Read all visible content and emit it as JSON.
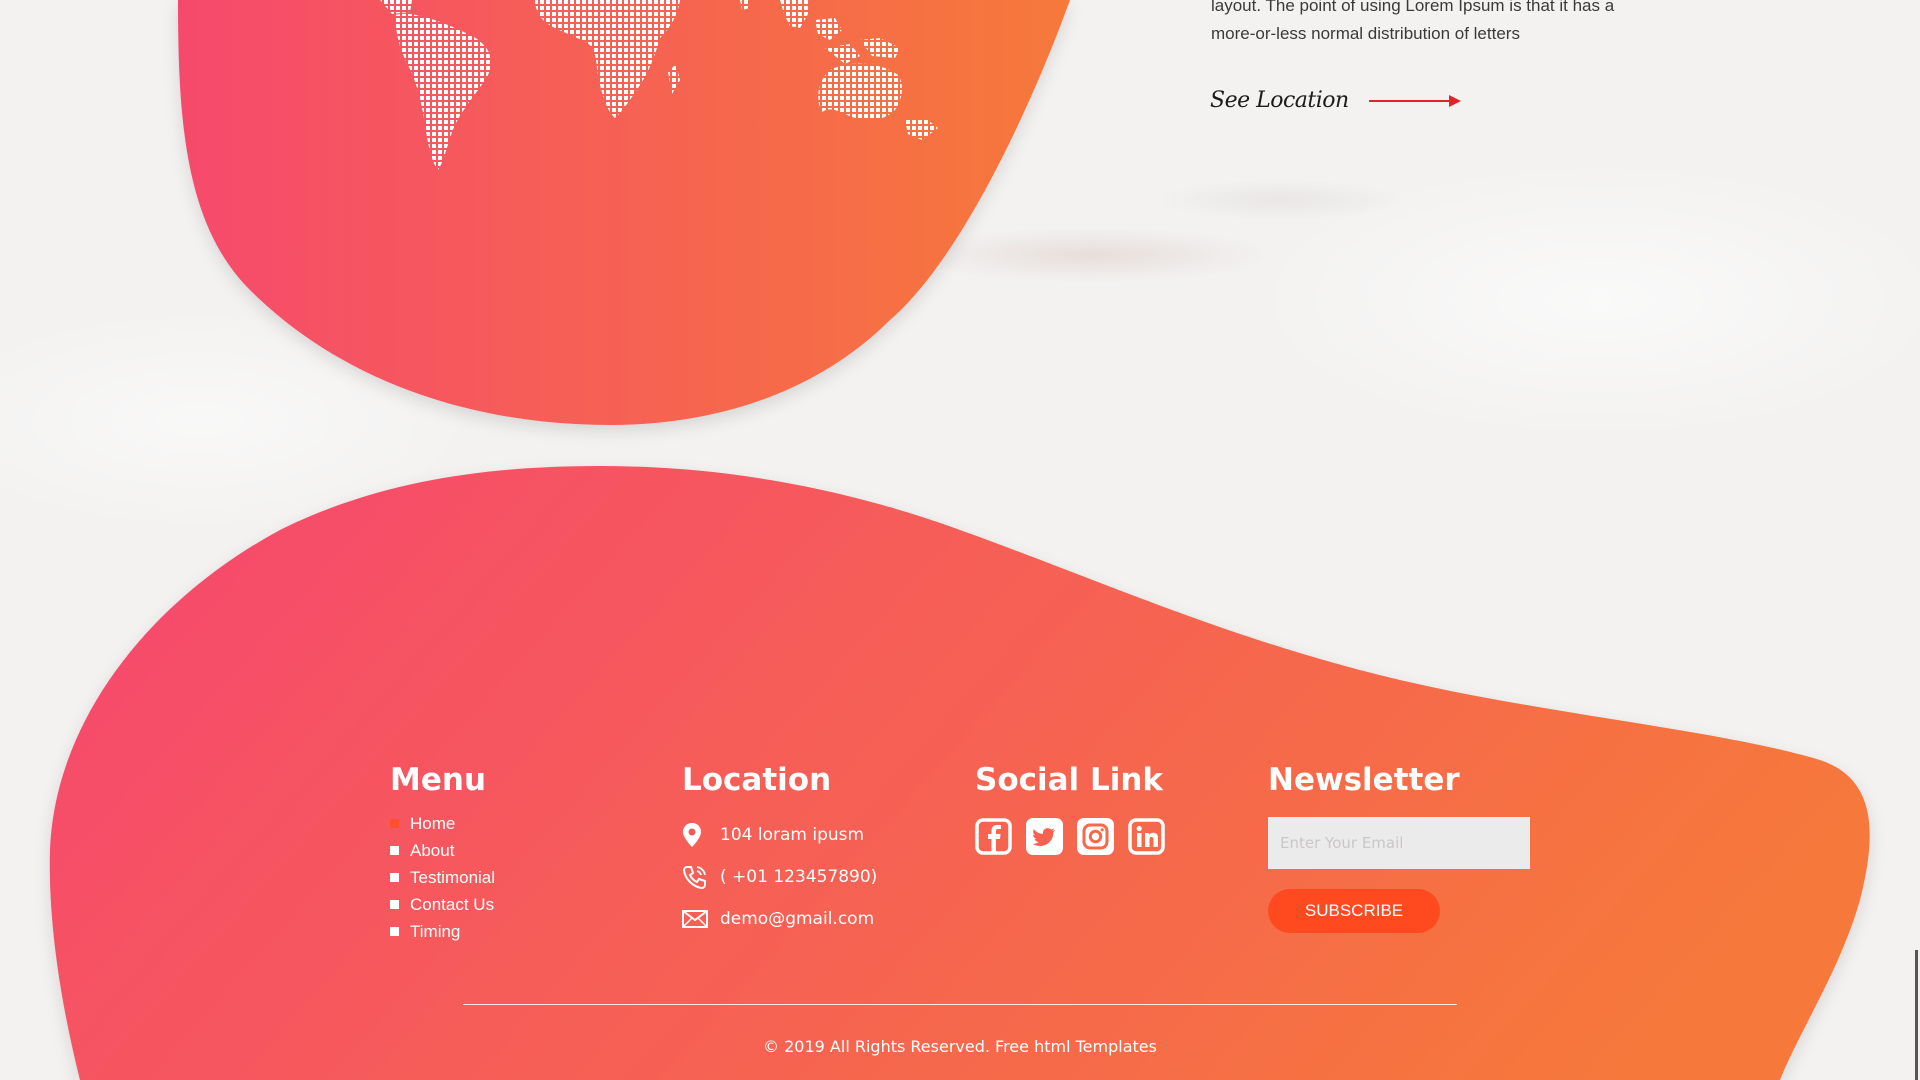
{
  "about": {
    "paragraph": "layout. The point of using Lorem Ipsum is that it has a more-or-less normal distribution of letters",
    "see_location": "See Location"
  },
  "footer": {
    "menu": {
      "title": "Menu",
      "items": [
        "Home",
        "About",
        "Testimonial",
        "Contact Us",
        "Timing"
      ]
    },
    "location": {
      "title": "Location",
      "address": "104 loram ipusm",
      "phone": "( +01 123457890)",
      "email": "demo@gmail.com"
    },
    "social": {
      "title": "Social Link",
      "icons": [
        "facebook-icon",
        "twitter-icon",
        "instagram-icon",
        "linkedin-icon"
      ]
    },
    "newsletter": {
      "title": "Newsletter",
      "placeholder": "Enter Your Email",
      "button": "SUBSCRIBE"
    },
    "copyright": "© 2019 All Rights Reserved. Free html Templates"
  },
  "colors": {
    "gradient_start": "#f64b6a",
    "gradient_end": "#f6763a",
    "accent": "#ff4a1f",
    "background": "#f3f2f1"
  }
}
